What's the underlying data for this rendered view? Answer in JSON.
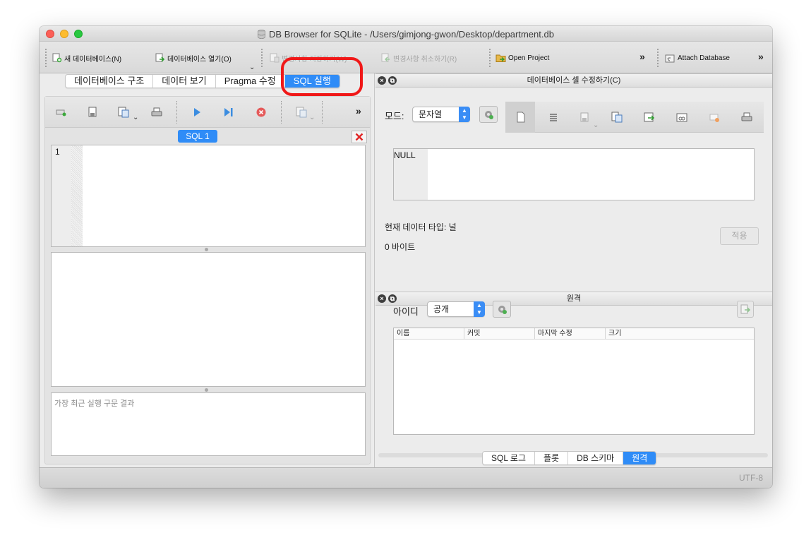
{
  "window": {
    "title": "DB Browser for SQLite - /Users/gimjong-gwon/Desktop/department.db"
  },
  "toolbar": {
    "new_db": "새 데이터베이스(N)",
    "open_db": "데이터베이스 열기(O)",
    "write_changes": "변경사항 저장하기(W)",
    "revert_changes": "변경사항 취소하기(R)",
    "open_project": "Open Project",
    "attach_db": "Attach Database",
    "more": "»"
  },
  "main_tabs": [
    {
      "label": "데이터베이스 구조",
      "active": false
    },
    {
      "label": "데이터 보기",
      "active": false
    },
    {
      "label": "Pragma 수정",
      "active": false
    },
    {
      "label": "SQL 실행",
      "active": true
    }
  ],
  "sql_editor": {
    "tab_label": "SQL 1",
    "line_numbers": [
      "1"
    ],
    "content": "",
    "message_placeholder": "가장 최근 실행 구문 결과"
  },
  "edit_cell": {
    "title": "데이터베이스 셀 수정하기(C)",
    "mode_label": "모드:",
    "mode_value": "문자열",
    "cell_value": "NULL",
    "data_type": "현재 데이터 타입: 널",
    "size": "0 바이트",
    "apply_label": "적용"
  },
  "remote": {
    "title": "원격",
    "id_label": "아이디",
    "id_value": "공개",
    "columns": [
      "이름",
      "커밋",
      "마지막 수정",
      "크기"
    ],
    "rows": []
  },
  "bottom_tabs": [
    {
      "label": "SQL 로그",
      "active": false
    },
    {
      "label": "플롯",
      "active": false
    },
    {
      "label": "DB 스키마",
      "active": false
    },
    {
      "label": "원격",
      "active": true
    }
  ],
  "status": {
    "encoding": "UTF-8"
  },
  "colors": {
    "accent": "#2f8cf7",
    "highlight_ring": "#f01818"
  }
}
